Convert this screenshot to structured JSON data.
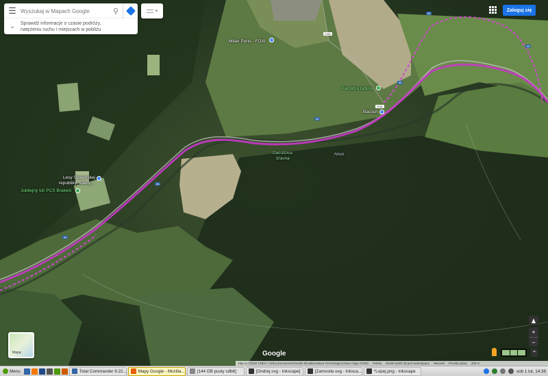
{
  "search": {
    "placeholder": "Wyszukaj w Mapach Google",
    "traffic_line1": "Sprawdź informacje o czasie podróży,",
    "traffic_line2": "natężeniu ruchu i miejscach w pobliżu"
  },
  "header": {
    "signin_label": "Zaloguj się"
  },
  "labels": {
    "milan_porio": "Milan Porio - FOXI",
    "pamatna_tabula": "Pamätná tabuľa",
    "bacuch": "Bacúch",
    "lesy_line1": "Lesy Slovenskej",
    "lesy_line2": "republiky, štátny...",
    "jubilejny": "Jubilejný lúč PCS Brakeši",
    "dacusova1": "Dacúšova",
    "dacusova2": "šťavna",
    "hron": "Hron",
    "shield_66_a": "66",
    "shield_66_b": "66",
    "shield_66_c": "66",
    "shield_66_d": "66",
    "shield_66_e": "66",
    "shield_66_f": "66",
    "shield_2380": "2380",
    "shield_2381": "2381"
  },
  "controls": {
    "minimap_label": "Mapa",
    "google": "Google",
    "zoom_in": "+",
    "zoom_out": "−",
    "expand": "⌃"
  },
  "attribution": {
    "imagery": "Zdjęcia ©2020 CNES / Airbus,Eurosense/Geodis Slovakia,Maxar Technologies,Dane mapy ©2020",
    "country": "Polska",
    "earth": "Widok Earth 3D jest niedostępny",
    "terms": "Warunki",
    "feedback": "Prześlij opinię",
    "scale": "200 m"
  },
  "taskbar": {
    "menu": "Menu",
    "tasks": [
      {
        "label": "Total Commander 9.22..."
      },
      {
        "label": "Mapy Google - Mozilla..."
      },
      {
        "label": "[144 GB pusty sdb6]"
      },
      {
        "label": "[Ondrej.svg - Inkscape]"
      },
      {
        "label": "[Zamostie.svg - Inksca..."
      },
      {
        "label": "*Lopej.png - Inkscape"
      }
    ],
    "clock": "sob 1 lut, 14:39"
  },
  "colors": {
    "route": "#c838c8",
    "accent": "#1a73e8"
  }
}
